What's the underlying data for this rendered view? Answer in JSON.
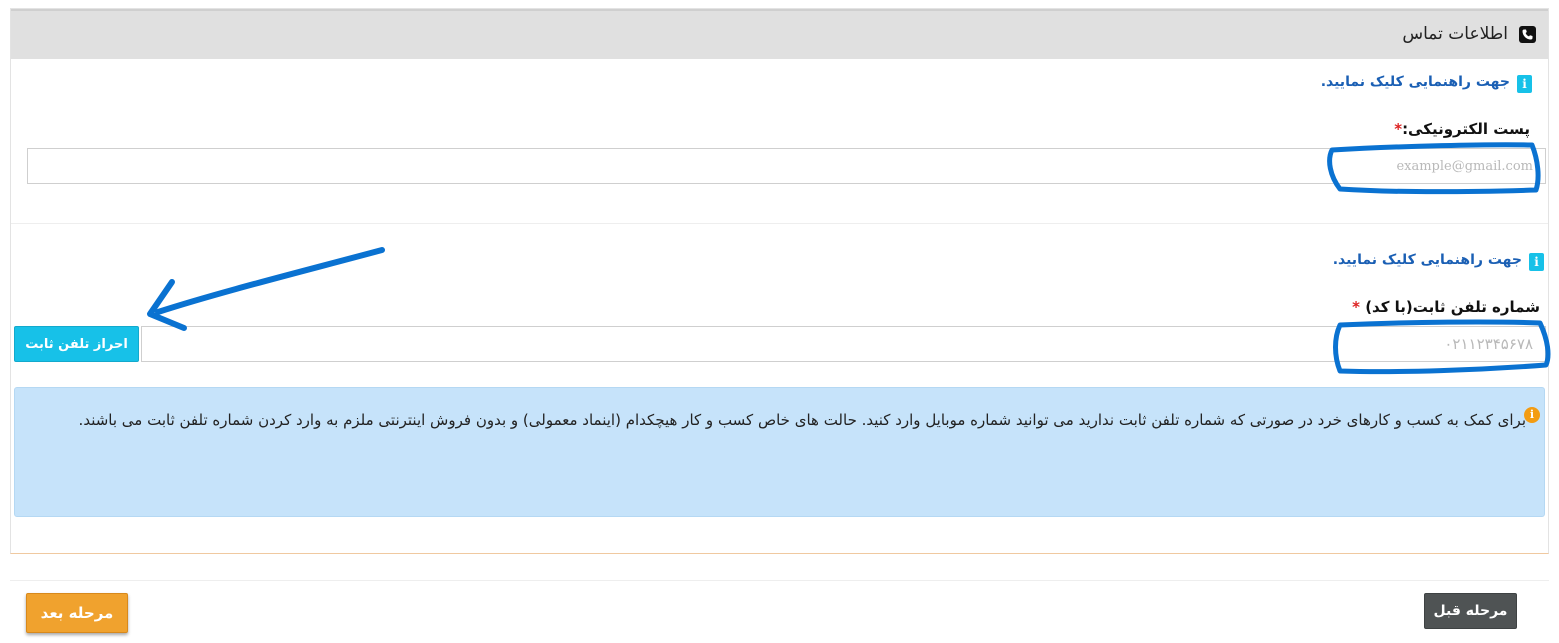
{
  "panel": {
    "title": "اطلاعات تماس",
    "icon": "phone-icon"
  },
  "email_section": {
    "help_text": "جهت راهنمایی کلیک نمایید.",
    "help_icon": "info-icon",
    "label": "پست الکترونیکی:",
    "required_mark": "*",
    "value": "",
    "placeholder": "example@gmail.com"
  },
  "phone_section": {
    "help_text": "جهت راهنمایی کلیک نمایید.",
    "help_icon": "info-icon",
    "label": "شماره تلفن ثابت(با کد)",
    "required_mark": "*",
    "value": "",
    "placeholder": "۰۲۱۱۲۳۴۵۶۷۸",
    "verify_button": "احراز تلفن ثابت"
  },
  "notice": {
    "icon": "warning-info-icon",
    "text": "برای کمک به کسب و کارهای خرد در صورتی که شماره تلفن ثابت ندارید می توانید شماره موبایل وارد کنید. حالت های خاص کسب و کار هیچکدام (اینماد معمولی) و بدون فروش اینترنتی ملزم به وارد کردن شماره تلفن ثابت می باشند."
  },
  "footer": {
    "next_button": "مرحله بعد",
    "prev_button": "مرحله قبل"
  },
  "colors": {
    "header_bg": "#e0e0e0",
    "info_accent": "#17c1e8",
    "link": "#1a5fb4",
    "notice_bg": "#c6e3fa",
    "next_button": "#f0a22e",
    "prev_button": "#4f5354",
    "annotation": "#0a72d1"
  }
}
